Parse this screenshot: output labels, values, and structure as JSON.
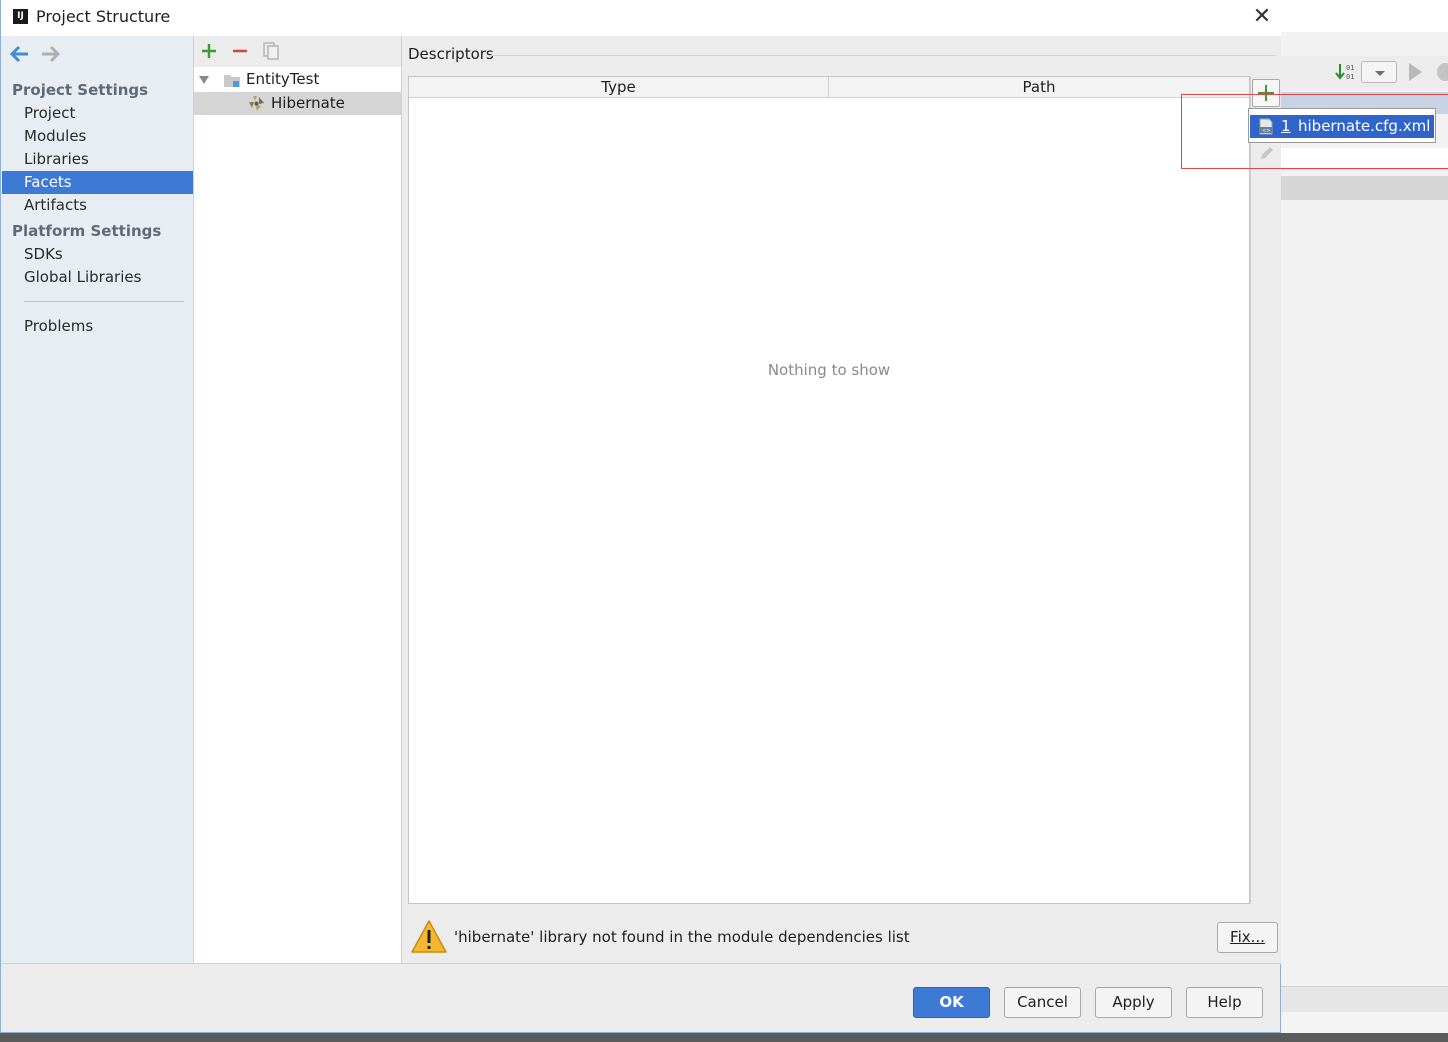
{
  "window": {
    "title": "Project Structure",
    "app_icon": "intellij-icon",
    "close_icon": "close-icon"
  },
  "nav": {
    "back_icon": "back-arrow-icon",
    "forward_icon": "forward-arrow-icon",
    "project_settings": "Project Settings",
    "project_items": [
      "Project",
      "Modules",
      "Libraries",
      "Facets",
      "Artifacts"
    ],
    "selected": "Facets",
    "platform_settings": "Platform Settings",
    "platform_items": [
      "SDKs",
      "Global Libraries"
    ],
    "problems": "Problems"
  },
  "tree": {
    "toolbar_icons": [
      "add-icon",
      "remove-icon",
      "copy-icon"
    ],
    "items": [
      {
        "label": "EntityTest",
        "icon": "module-folder-icon",
        "expanded": true
      },
      {
        "label": "Hibernate",
        "icon": "hibernate-icon",
        "selected": true
      }
    ]
  },
  "descriptors": {
    "section_label": "Descriptors",
    "columns": [
      "Type",
      "Path"
    ],
    "empty_text": "Nothing to show",
    "toolbar_icons": [
      "add-icon",
      "edit-icon"
    ]
  },
  "popup": {
    "number": "1",
    "label": "hibernate.cfg.xml",
    "icon": "xml-file-icon"
  },
  "warning": {
    "icon": "warning-icon",
    "text": "'hibernate' library not found in the module dependencies list",
    "fix_label": "Fix..."
  },
  "buttons": {
    "ok": "OK",
    "cancel": "Cancel",
    "apply": "Apply",
    "help": "Help"
  },
  "colors": {
    "accent": "#3d7ad6",
    "popup_selection": "#2f65ca",
    "add_green": "#3a9b3a",
    "remove_red": "#d64040",
    "highlight_red": "#e04848"
  }
}
